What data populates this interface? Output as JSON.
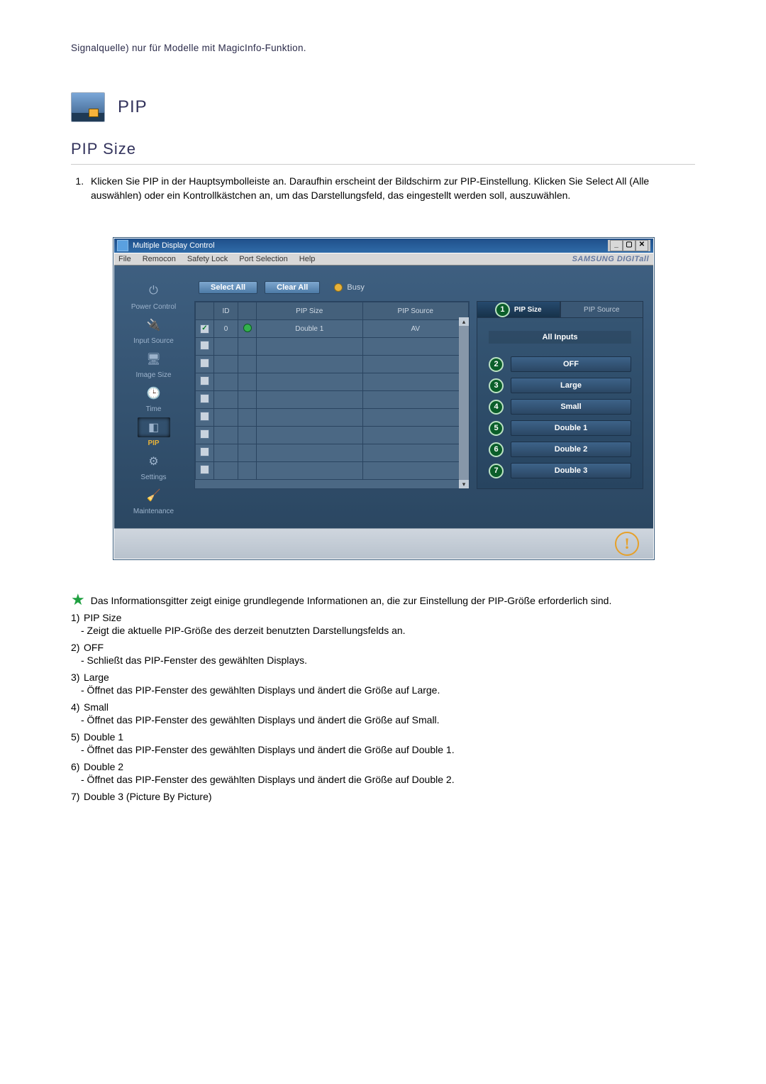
{
  "top_note": "Signalquelle) nur für Modelle mit MagicInfo-Funktion.",
  "pip_heading": "PIP",
  "pip_size_heading": "PIP Size",
  "instructions": [
    "Klicken Sie PIP in der Hauptsymbolleiste an. Daraufhin erscheint der Bildschirm zur PIP-Einstellung. Klicken Sie Select All (Alle auswählen) oder ein Kontrollkästchen an, um das Darstellungsfeld, das eingestellt werden soll, auszuwählen."
  ],
  "app": {
    "title": "Multiple Display Control",
    "menu": [
      "File",
      "Remocon",
      "Safety Lock",
      "Port Selection",
      "Help"
    ],
    "brand": "SAMSUNG DIGITall",
    "toolbar": {
      "select_all": "Select All",
      "clear_all": "Clear All",
      "busy": "Busy"
    },
    "sidebar": [
      {
        "label": "Power Control",
        "active": false,
        "icon": "⏻"
      },
      {
        "label": "Input Source",
        "active": false,
        "icon": "🔌"
      },
      {
        "label": "Image Size",
        "active": false,
        "icon": "🖥"
      },
      {
        "label": "Time",
        "active": false,
        "icon": "🕒"
      },
      {
        "label": "PIP",
        "active": true,
        "icon": "◧"
      },
      {
        "label": "Settings",
        "active": false,
        "icon": "⚙"
      },
      {
        "label": "Maintenance",
        "active": false,
        "icon": "🧹"
      }
    ],
    "grid": {
      "headers": [
        "",
        "ID",
        "",
        "PIP Size",
        "PIP Source"
      ],
      "rows": [
        {
          "checked": true,
          "id": "0",
          "status": "on",
          "size": "Double 1",
          "source": "AV"
        },
        {
          "checked": false,
          "id": "",
          "status": "",
          "size": "",
          "source": ""
        },
        {
          "checked": false,
          "id": "",
          "status": "",
          "size": "",
          "source": ""
        },
        {
          "checked": false,
          "id": "",
          "status": "",
          "size": "",
          "source": ""
        },
        {
          "checked": false,
          "id": "",
          "status": "",
          "size": "",
          "source": ""
        },
        {
          "checked": false,
          "id": "",
          "status": "",
          "size": "",
          "source": ""
        },
        {
          "checked": false,
          "id": "",
          "status": "",
          "size": "",
          "source": ""
        },
        {
          "checked": false,
          "id": "",
          "status": "",
          "size": "",
          "source": ""
        },
        {
          "checked": false,
          "id": "",
          "status": "",
          "size": "",
          "source": ""
        }
      ]
    },
    "panel": {
      "tabs": [
        {
          "label": "PIP Size",
          "num": "1",
          "active": true
        },
        {
          "label": "PIP Source",
          "active": false
        }
      ],
      "section_title": "All Inputs",
      "options": [
        {
          "num": "2",
          "label": "OFF"
        },
        {
          "num": "3",
          "label": "Large"
        },
        {
          "num": "4",
          "label": "Small"
        },
        {
          "num": "5",
          "label": "Double 1"
        },
        {
          "num": "6",
          "label": "Double 2"
        },
        {
          "num": "7",
          "label": "Double 3"
        }
      ]
    }
  },
  "star_note": "Das Informationsgitter zeigt einige grundlegende Informationen an, die zur Einstellung der PIP-Größe erforderlich sind.",
  "notes": [
    {
      "num": "1)",
      "title": "PIP Size",
      "desc": "- Zeigt die aktuelle PIP-Größe des derzeit benutzten Darstellungsfelds an."
    },
    {
      "num": "2)",
      "title": "OFF",
      "desc": "- Schließt das PIP-Fenster des gewählten Displays."
    },
    {
      "num": "3)",
      "title": "Large",
      "desc": "- Öffnet das PIP-Fenster des gewählten Displays und ändert die Größe auf Large."
    },
    {
      "num": "4)",
      "title": "Small",
      "desc": "- Öffnet das PIP-Fenster des gewählten Displays und ändert die Größe auf Small."
    },
    {
      "num": "5)",
      "title": "Double 1",
      "desc": "- Öffnet das PIP-Fenster des gewählten Displays und ändert die Größe auf Double 1."
    },
    {
      "num": "6)",
      "title": "Double 2",
      "desc": "- Öffnet das PIP-Fenster des gewählten Displays und ändert die Größe auf Double 2."
    },
    {
      "num": "7)",
      "title": "Double 3 (Picture By Picture)",
      "desc": ""
    }
  ]
}
